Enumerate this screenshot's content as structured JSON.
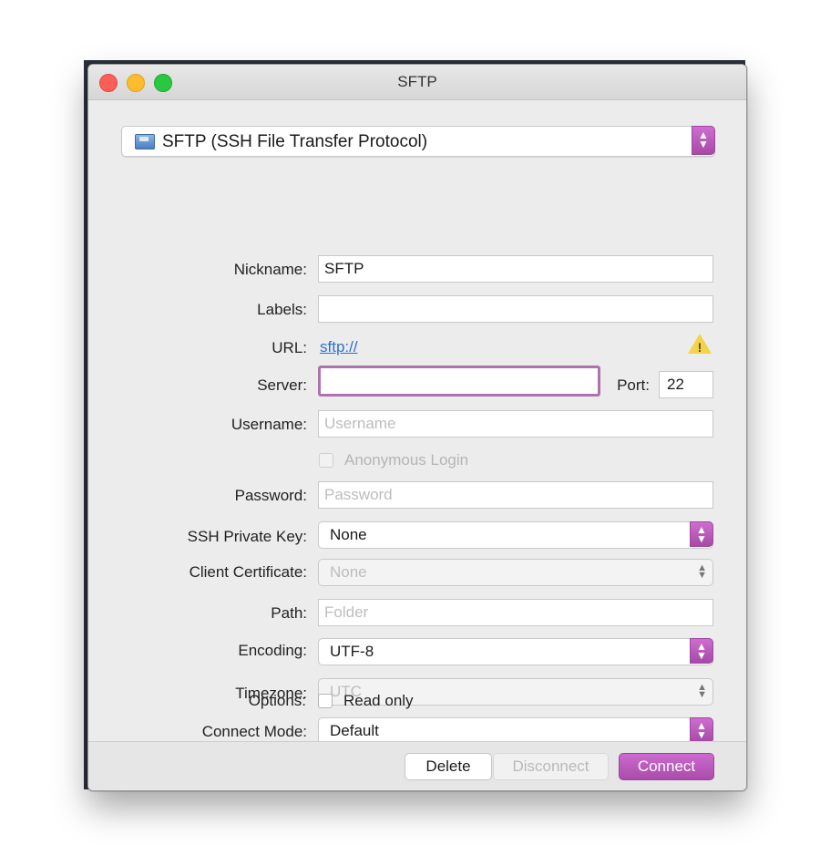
{
  "window": {
    "title": "SFTP"
  },
  "protocol": {
    "selected": "SFTP (SSH File Transfer Protocol)",
    "icon": "disk-icon"
  },
  "form": {
    "nickname": {
      "label": "Nickname:",
      "value": "SFTP"
    },
    "labels": {
      "label": "Labels:",
      "value": ""
    },
    "url": {
      "label": "URL:",
      "value": "sftp://"
    },
    "server": {
      "label": "Server:",
      "value": ""
    },
    "port": {
      "label": "Port:",
      "value": "22"
    },
    "username": {
      "label": "Username:",
      "placeholder": "Username"
    },
    "anonymous": {
      "label": "Anonymous Login",
      "checked": false,
      "enabled": false
    },
    "password": {
      "label": "Password:",
      "placeholder": "Password"
    },
    "ssh_key": {
      "label": "SSH Private Key:",
      "value": "None"
    },
    "client_cert": {
      "label": "Client Certificate:",
      "value": "None",
      "enabled": false
    },
    "path": {
      "label": "Path:",
      "placeholder": "Folder"
    },
    "encoding": {
      "label": "Encoding:",
      "value": "UTF-8"
    },
    "timezone": {
      "label": "Timezone:",
      "value": "UTC",
      "enabled": false
    },
    "connect_mode": {
      "label": "Connect Mode:",
      "value": "Default"
    },
    "options": {
      "label": "Options:",
      "read_only_label": "Read only",
      "read_only": false
    }
  },
  "footer": {
    "delete_label": "Delete",
    "disconnect_label": "Disconnect",
    "connect_label": "Connect"
  },
  "colors": {
    "accent": "#b657b8",
    "link": "#2d6ed6",
    "warning": "#f3d34a"
  }
}
